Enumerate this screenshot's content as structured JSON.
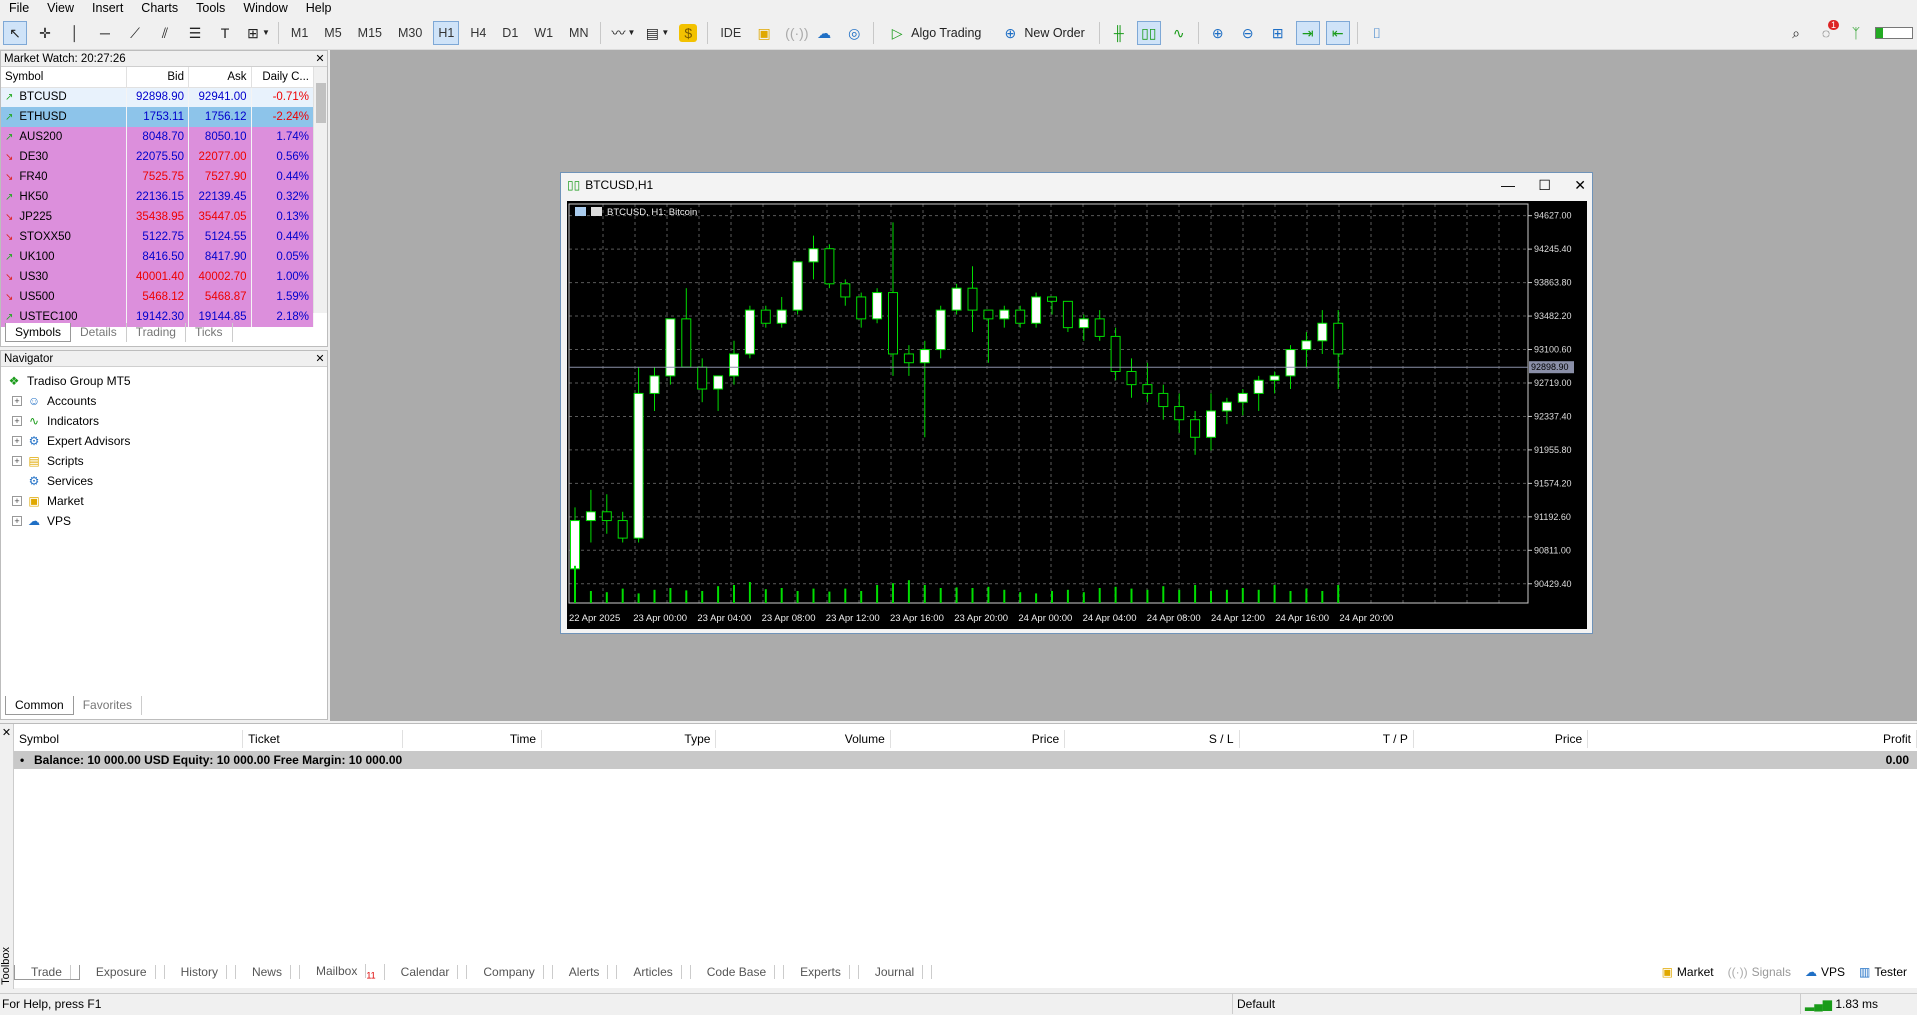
{
  "menu": [
    "File",
    "View",
    "Insert",
    "Charts",
    "Tools",
    "Window",
    "Help"
  ],
  "timeframes": [
    "M1",
    "M5",
    "M15",
    "M30",
    "H1",
    "H4",
    "D1",
    "W1",
    "MN"
  ],
  "active_timeframe": "H1",
  "toolbar": {
    "ide": "IDE",
    "algo": "Algo Trading",
    "new_order": "New Order",
    "notif_count": "1"
  },
  "market_watch": {
    "title": "Market Watch: 20:27:26",
    "columns": [
      "Symbol",
      "Bid",
      "Ask",
      "Daily C..."
    ],
    "rows": [
      {
        "symbol": "BTCUSD",
        "bid": "92898.90",
        "ask": "92941.00",
        "change": "-0.71%",
        "dir": "up",
        "bidc": "pos",
        "askc": "pos",
        "chc": "neg",
        "style": "first"
      },
      {
        "symbol": "ETHUSD",
        "bid": "1753.11",
        "ask": "1756.12",
        "change": "-2.24%",
        "dir": "up",
        "bidc": "pos",
        "askc": "pos",
        "chc": "neg",
        "style": "hl"
      },
      {
        "symbol": "AUS200",
        "bid": "8048.70",
        "ask": "8050.10",
        "change": "1.74%",
        "dir": "up",
        "bidc": "pos",
        "askc": "pos",
        "chc": "pos",
        "style": "r"
      },
      {
        "symbol": "DE30",
        "bid": "22075.50",
        "ask": "22077.00",
        "change": "0.56%",
        "dir": "dn",
        "bidc": "pos",
        "askc": "neg",
        "chc": "pos",
        "style": "r"
      },
      {
        "symbol": "FR40",
        "bid": "7525.75",
        "ask": "7527.90",
        "change": "0.44%",
        "dir": "dn",
        "bidc": "neg",
        "askc": "neg",
        "chc": "pos",
        "style": "r"
      },
      {
        "symbol": "HK50",
        "bid": "22136.15",
        "ask": "22139.45",
        "change": "0.32%",
        "dir": "up",
        "bidc": "pos",
        "askc": "pos",
        "chc": "pos",
        "style": "r"
      },
      {
        "symbol": "JP225",
        "bid": "35438.95",
        "ask": "35447.05",
        "change": "0.13%",
        "dir": "dn",
        "bidc": "neg",
        "askc": "neg",
        "chc": "pos",
        "style": "r"
      },
      {
        "symbol": "STOXX50",
        "bid": "5122.75",
        "ask": "5124.55",
        "change": "0.44%",
        "dir": "dn",
        "bidc": "pos",
        "askc": "pos",
        "chc": "pos",
        "style": "r"
      },
      {
        "symbol": "UK100",
        "bid": "8416.50",
        "ask": "8417.90",
        "change": "0.05%",
        "dir": "up",
        "bidc": "pos",
        "askc": "pos",
        "chc": "pos",
        "style": "r"
      },
      {
        "symbol": "US30",
        "bid": "40001.40",
        "ask": "40002.70",
        "change": "1.00%",
        "dir": "dn",
        "bidc": "neg",
        "askc": "neg",
        "chc": "pos",
        "style": "r"
      },
      {
        "symbol": "US500",
        "bid": "5468.12",
        "ask": "5468.87",
        "change": "1.59%",
        "dir": "dn",
        "bidc": "neg",
        "askc": "neg",
        "chc": "pos",
        "style": "r"
      },
      {
        "symbol": "USTEC100",
        "bid": "19142.30",
        "ask": "19144.85",
        "change": "2.18%",
        "dir": "up",
        "bidc": "pos",
        "askc": "pos",
        "chc": "pos",
        "style": "r"
      }
    ],
    "tabs": [
      "Symbols",
      "Details",
      "Trading",
      "Ticks"
    ]
  },
  "navigator": {
    "title": "Navigator",
    "root": "Tradiso Group MT5",
    "items": [
      {
        "label": "Accounts",
        "icon": "accounts-icon",
        "exp": true
      },
      {
        "label": "Indicators",
        "icon": "indicators-icon",
        "exp": true
      },
      {
        "label": "Expert Advisors",
        "icon": "expert-advisors-icon",
        "exp": true
      },
      {
        "label": "Scripts",
        "icon": "scripts-icon",
        "exp": true
      },
      {
        "label": "Services",
        "icon": "services-icon",
        "exp": false
      },
      {
        "label": "Market",
        "icon": "market-icon",
        "exp": true
      },
      {
        "label": "VPS",
        "icon": "vps-icon",
        "exp": true
      }
    ],
    "tabs": [
      "Common",
      "Favorites"
    ]
  },
  "chart_window": {
    "title": "BTCUSD,H1",
    "label": "BTCUSD, H1:  Bitcoin",
    "current_price": "92898.90"
  },
  "chart_data": {
    "type": "candlestick",
    "symbol": "BTCUSD",
    "timeframe": "H1",
    "y_ticks": [
      "94627.00",
      "94245.40",
      "93863.80",
      "93482.20",
      "93100.60",
      "92719.00",
      "92337.40",
      "91955.80",
      "91574.20",
      "91192.60",
      "90811.00",
      "90429.40"
    ],
    "ylim": [
      90210,
      94760
    ],
    "x_ticks": [
      "22 Apr 2025",
      "23 Apr 00:00",
      "23 Apr 04:00",
      "23 Apr 08:00",
      "23 Apr 12:00",
      "23 Apr 16:00",
      "23 Apr 20:00",
      "24 Apr 00:00",
      "24 Apr 04:00",
      "24 Apr 08:00",
      "24 Apr 12:00",
      "24 Apr 16:00",
      "24 Apr 20:00"
    ],
    "candles": [
      [
        90600,
        91300,
        90400,
        91150
      ],
      [
        91150,
        91500,
        90900,
        91250
      ],
      [
        91250,
        91450,
        91000,
        91150
      ],
      [
        91150,
        91250,
        90900,
        90950
      ],
      [
        90950,
        92900,
        90900,
        92600
      ],
      [
        92600,
        92900,
        92400,
        92800
      ],
      [
        92800,
        93300,
        92700,
        93450
      ],
      [
        93450,
        93800,
        92900,
        92900
      ],
      [
        92900,
        93000,
        92500,
        92650
      ],
      [
        92650,
        92800,
        92400,
        92800
      ],
      [
        92800,
        93200,
        92700,
        93050
      ],
      [
        93050,
        93600,
        93000,
        93550
      ],
      [
        93550,
        93600,
        93350,
        93400
      ],
      [
        93400,
        93700,
        93350,
        93550
      ],
      [
        93550,
        94000,
        93500,
        94100
      ],
      [
        94100,
        94400,
        93900,
        94250
      ],
      [
        94250,
        94300,
        93800,
        93850
      ],
      [
        93850,
        93900,
        93600,
        93700
      ],
      [
        93700,
        93750,
        93350,
        93450
      ],
      [
        93450,
        93800,
        93400,
        93750
      ],
      [
        93750,
        94550,
        92800,
        93050
      ],
      [
        93050,
        93150,
        92800,
        92950
      ],
      [
        92950,
        93200,
        92100,
        93100
      ],
      [
        93100,
        93600,
        93000,
        93550
      ],
      [
        93550,
        93850,
        93500,
        93800
      ],
      [
        93800,
        94050,
        93300,
        93550
      ],
      [
        93550,
        93550,
        92950,
        93450
      ],
      [
        93450,
        93600,
        93350,
        93550
      ],
      [
        93550,
        93600,
        93350,
        93400
      ],
      [
        93400,
        93750,
        93350,
        93700
      ],
      [
        93700,
        93700,
        93500,
        93650
      ],
      [
        93650,
        93650,
        93300,
        93350
      ],
      [
        93350,
        93500,
        93200,
        93450
      ],
      [
        93450,
        93550,
        93200,
        93250
      ],
      [
        93250,
        93350,
        92750,
        92850
      ],
      [
        92850,
        93000,
        92550,
        92700
      ],
      [
        92700,
        92950,
        92500,
        92600
      ],
      [
        92600,
        92700,
        92300,
        92450
      ],
      [
        92450,
        92600,
        92150,
        92300
      ],
      [
        92300,
        92400,
        91900,
        92100
      ],
      [
        92100,
        92600,
        91950,
        92400
      ],
      [
        92400,
        92550,
        92250,
        92500
      ],
      [
        92500,
        92650,
        92350,
        92600
      ],
      [
        92600,
        92800,
        92400,
        92750
      ],
      [
        92750,
        92850,
        92600,
        92800
      ],
      [
        92800,
        93150,
        92650,
        93100
      ],
      [
        93100,
        93300,
        92900,
        93200
      ],
      [
        93200,
        93550,
        93050,
        93400
      ],
      [
        93400,
        93550,
        92650,
        93050
      ]
    ],
    "volumes": [
      0.62,
      0.2,
      0.18,
      0.24,
      0.16,
      0.22,
      0.25,
      0.21,
      0.2,
      0.28,
      0.3,
      0.35,
      0.23,
      0.25,
      0.2,
      0.24,
      0.19,
      0.24,
      0.2,
      0.3,
      0.33,
      0.38,
      0.3,
      0.25,
      0.26,
      0.25,
      0.27,
      0.22,
      0.18,
      0.16,
      0.2,
      0.22,
      0.18,
      0.25,
      0.27,
      0.24,
      0.22,
      0.28,
      0.22,
      0.3,
      0.2,
      0.22,
      0.25,
      0.22,
      0.3,
      0.2,
      0.24,
      0.2,
      0.3
    ]
  },
  "terminal": {
    "columns": [
      "Symbol",
      "Ticket",
      "Time",
      "Type",
      "Volume",
      "Price",
      "S / L",
      "T / P",
      "Price",
      "Profit"
    ],
    "balance": "Balance: 10 000.00 USD  Equity: 10 000.00  Free Margin: 10 000.00",
    "profit": "0.00",
    "side_label": "Toolbox",
    "tabs": [
      "Trade",
      "Exposure",
      "History",
      "News",
      "Mailbox",
      "Calendar",
      "Company",
      "Alerts",
      "Articles",
      "Code Base",
      "Experts",
      "Journal"
    ],
    "mailbox_count": "11",
    "right": [
      "Market",
      "Signals",
      "VPS",
      "Tester"
    ]
  },
  "status": {
    "help": "For Help, press F1",
    "profile": "Default",
    "ping": "1.83 ms"
  }
}
